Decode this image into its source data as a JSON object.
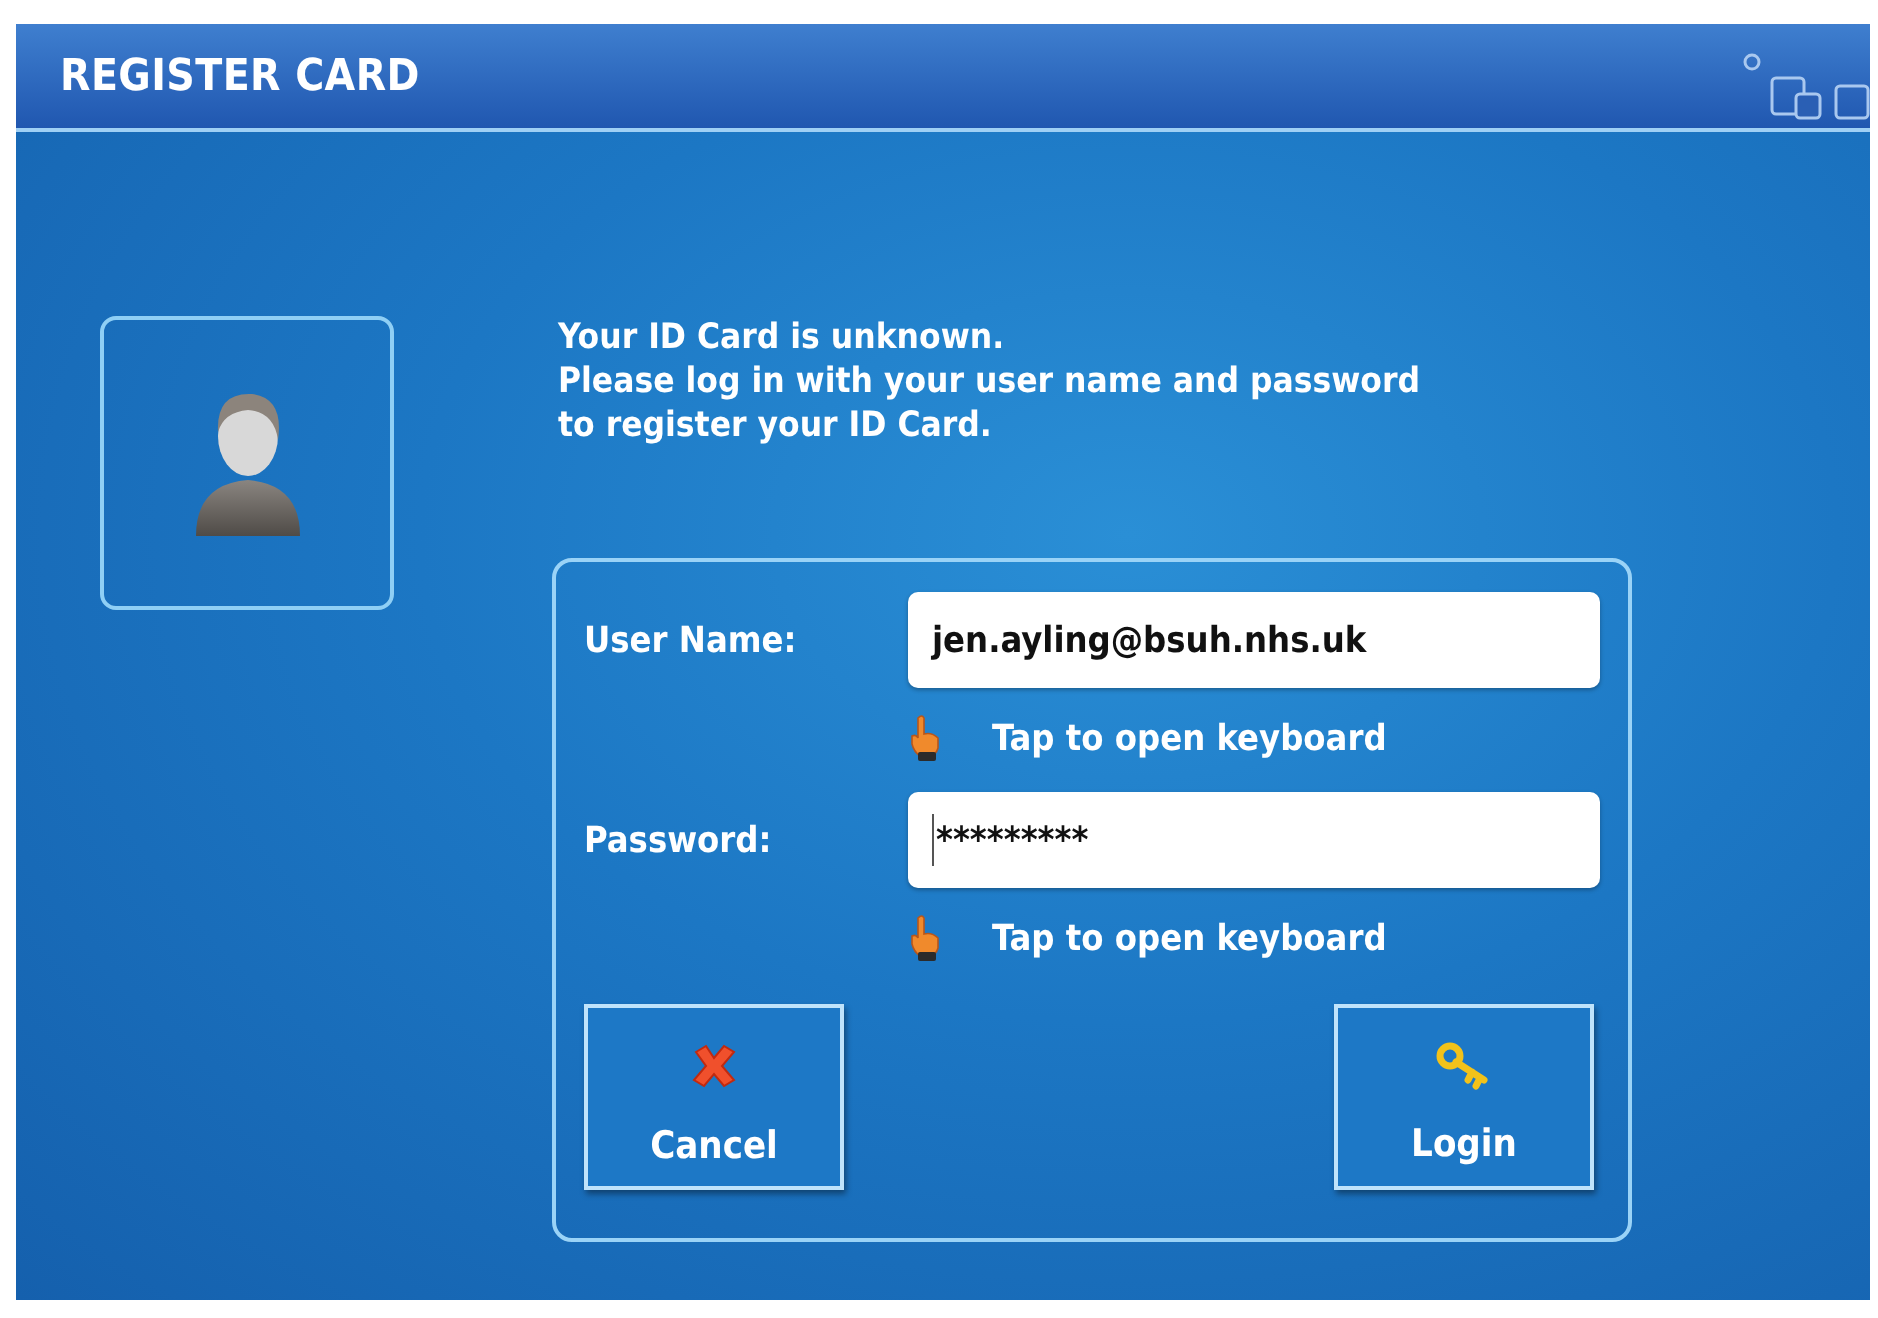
{
  "window": {
    "title": "REGISTER CARD"
  },
  "message": [
    "Your ID Card is unknown.",
    "Please log in with your user name and password",
    "to register your ID Card."
  ],
  "fields": [
    {
      "label": "User Name:",
      "value": "jen.ayling@bsuh.nhs.uk",
      "focused": false,
      "hint": "Tap to open keyboard"
    },
    {
      "label": "Password:",
      "value": "*********",
      "focused": true,
      "hint": "Tap to open keyboard"
    }
  ],
  "buttons": [
    {
      "label": "Cancel",
      "kind": "cancel"
    },
    {
      "label": "Login",
      "kind": "login"
    }
  ]
}
